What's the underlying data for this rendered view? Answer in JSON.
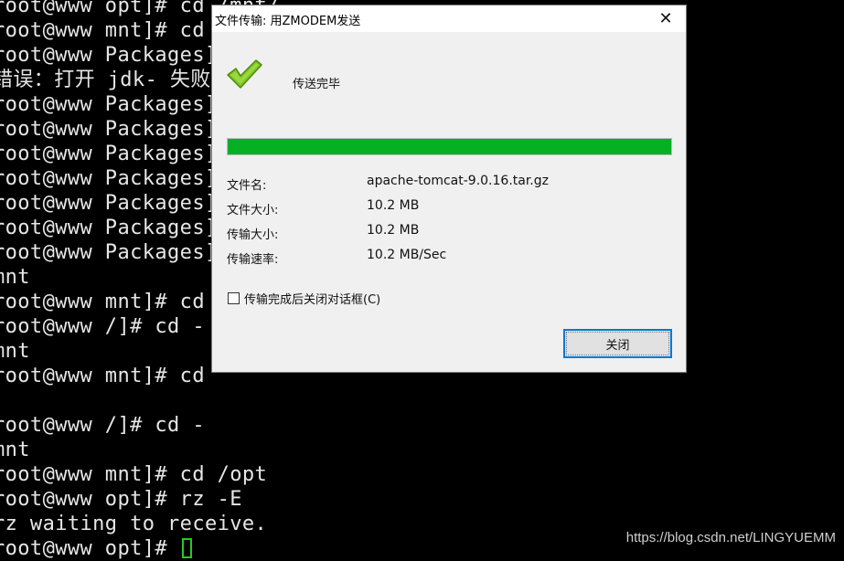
{
  "terminal": {
    "lines": [
      "root@www opt]# cd /mnt/",
      "root@www mnt]# cd",
      "root@www Packages]",
      "错误：打开 jdk- 失败",
      "root@www Packages]",
      "root@www Packages]",
      "root@www Packages]",
      "root@www Packages]",
      "root@www Packages]",
      "root@www Packages]",
      "root@www Packages]",
      "mnt",
      "root@www mnt]# cd",
      "root@www /]# cd -",
      "mnt",
      "root@www mnt]# cd",
      "",
      "root@www /]# cd -",
      "mnt",
      "root@www mnt]# cd /opt",
      "root@www opt]# rz -E",
      "rz waiting to receive.",
      "root@www opt]# "
    ],
    "cursor_color": "#22cc22"
  },
  "watermark": "https://blog.csdn.net/LINGYUEMM",
  "dialog": {
    "title": "文件传输: 用ZMODEM发送",
    "close_glyph": "✕",
    "status": "传送完毕",
    "check_icon": "checkmark-icon",
    "progress": 1.0,
    "progress_color": "#06b025",
    "fields": [
      {
        "label": "文件名:",
        "value": "apache-tomcat-9.0.16.tar.gz"
      },
      {
        "label": "文件大小:",
        "value": "10.2 MB"
      },
      {
        "label": "传输大小:",
        "value": "10.2 MB"
      },
      {
        "label": "传输速率:",
        "value": "10.2 MB/Sec"
      }
    ],
    "checkbox_label": "传输完成后关闭对话框(C)",
    "checkbox_checked": false,
    "close_button_label": "关闭"
  }
}
